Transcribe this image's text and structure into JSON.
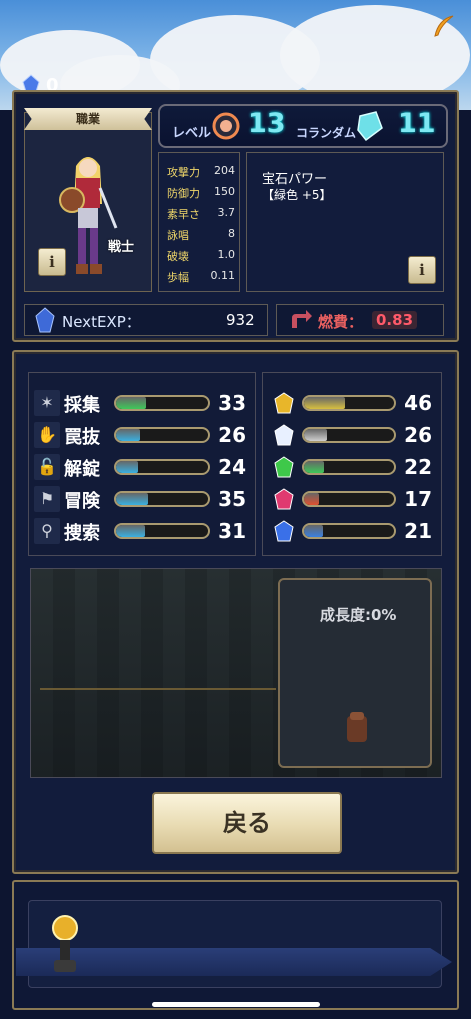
{
  "top": {
    "gem_count": "0"
  },
  "job": {
    "banner": "職業",
    "class_name": "戦士",
    "info_glyph": "i"
  },
  "level": {
    "label": "レベル",
    "value": "13",
    "corundum_label": "コランダム",
    "corundum_value": "11"
  },
  "stats": [
    {
      "name": "攻撃力",
      "value": "204"
    },
    {
      "name": "防御力",
      "value": "150"
    },
    {
      "name": "素早さ",
      "value": "3.7"
    },
    {
      "name": "詠唱",
      "value": "8"
    },
    {
      "name": "破壊",
      "value": "1.0"
    },
    {
      "name": "歩幅",
      "value": "0.11"
    }
  ],
  "gem_power": {
    "title": "宝石パワー",
    "detail": "【緑色 +5】",
    "info_glyph": "i"
  },
  "exp": {
    "label": "NextEXP：",
    "value": "932"
  },
  "fuel": {
    "label": "燃費：",
    "value": "0.83"
  },
  "skills": [
    {
      "name": "採集",
      "value": "33",
      "icon": "harvest-icon",
      "glyph": "✶",
      "fill": 0.33,
      "color": "#3fc85a"
    },
    {
      "name": "罠抜",
      "value": "26",
      "icon": "trap-icon",
      "glyph": "✋",
      "fill": 0.26,
      "color": "#3ab0e0"
    },
    {
      "name": "解錠",
      "value": "24",
      "icon": "lock-icon",
      "glyph": "🔓",
      "fill": 0.24,
      "color": "#3ab0e0"
    },
    {
      "name": "冒険",
      "value": "35",
      "icon": "adventure-icon",
      "glyph": "⚑",
      "fill": 0.35,
      "color": "#3ab0e0"
    },
    {
      "name": "捜索",
      "value": "31",
      "icon": "search-icon",
      "glyph": "⚲",
      "fill": 0.31,
      "color": "#3ab0e0"
    }
  ],
  "gems": [
    {
      "icon": "gold-gem-icon",
      "value": "46",
      "color": "#e8b62a",
      "fill": 0.46,
      "bar": "#d8c040"
    },
    {
      "icon": "diamond-icon",
      "value": "26",
      "color": "#e8f0ff",
      "fill": 0.26,
      "bar": "#cfcfcf"
    },
    {
      "icon": "emerald-icon",
      "value": "22",
      "color": "#3ec84a",
      "fill": 0.22,
      "bar": "#3fc85a"
    },
    {
      "icon": "ruby-icon",
      "value": "17",
      "color": "#e03a70",
      "fill": 0.17,
      "bar": "#e05030"
    },
    {
      "icon": "sapphire-icon",
      "value": "21",
      "color": "#3a70e8",
      "fill": 0.21,
      "bar": "#3a80e0"
    }
  ],
  "growth": {
    "label": "成長度:0%"
  },
  "back_button": {
    "label": "戻る"
  }
}
